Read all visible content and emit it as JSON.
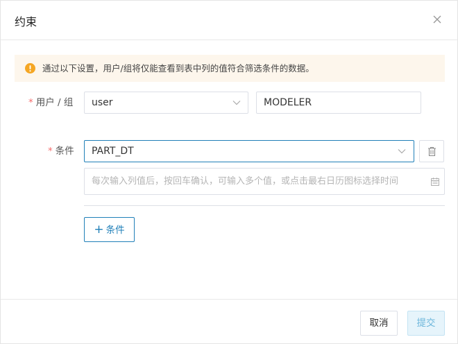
{
  "dialog": {
    "title": "约束"
  },
  "alert": {
    "text": "通过以下设置，用户/组将仅能查看到表中列的值符合筛选条件的数据。"
  },
  "user_row": {
    "required_mark": "*",
    "label": "用户 / 组",
    "type_value": "user",
    "name_value": "MODELER"
  },
  "condition_row": {
    "required_mark": "*",
    "label": "条件",
    "column_value": "PART_DT",
    "values_placeholder": "每次输入列值后，按回车确认，可输入多个值，或点击最右日历图标选择时间"
  },
  "add_condition_button": {
    "icon": "+",
    "label": "条件"
  },
  "footer": {
    "cancel_label": "取消",
    "submit_label": "提交"
  },
  "colors": {
    "primary": "#1f7fb8",
    "warning": "#f5a623",
    "alert_bg": "#fdf6ec",
    "required": "#f56c6c",
    "submit_bg": "#e6f4fb",
    "submit_text": "#6cb6db"
  }
}
